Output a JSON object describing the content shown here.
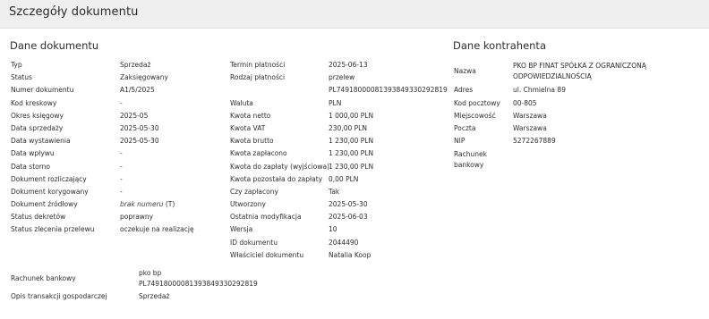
{
  "header": {
    "title": "Szczegóły dokumentu"
  },
  "sections": {
    "document": "Dane dokumentu",
    "contractor": "Dane kontrahenta"
  },
  "col1": [
    {
      "label": "Typ",
      "value": "Sprzedaż"
    },
    {
      "label": "Status",
      "value": "Zaksięgowany"
    },
    {
      "label": "Numer dokumentu",
      "value": "A1/5/2025"
    },
    {
      "label": "Kod kreskowy",
      "value": "-"
    },
    {
      "label": "Okres księgowy",
      "value": "2025-05"
    },
    {
      "label": "Data sprzedaży",
      "value": "2025-05-30"
    },
    {
      "label": "Data wystawienia",
      "value": "2025-05-30"
    },
    {
      "label": "Data wpływu",
      "value": "-"
    },
    {
      "label": "Data storno",
      "value": "-"
    },
    {
      "label": "Dokument rozliczający",
      "value": "-"
    },
    {
      "label": "Dokument korygowany",
      "value": "-"
    },
    {
      "label": "Dokument źródłowy",
      "value": "brak numeru",
      "value_suffix": " (T)"
    },
    {
      "label": "Status dekretów",
      "value": "poprawny"
    },
    {
      "label": "Status zlecenia przelewu",
      "value": "oczekuje na realizację"
    }
  ],
  "col2": [
    {
      "label": "Termin płatności",
      "value": "2025-06-13"
    },
    {
      "label": "Rodzaj płatności",
      "value": "przelew"
    },
    {
      "label": "",
      "value": "PL74918000081393849330292819"
    },
    {
      "label": "Waluta",
      "value": "PLN"
    },
    {
      "label": "Kwota netto",
      "value": "1 000,00 PLN"
    },
    {
      "label": "Kwota VAT",
      "value": "230,00 PLN"
    },
    {
      "label": "Kwota brutto",
      "value": "1 230,00 PLN"
    },
    {
      "label": "Kwota zapłacono",
      "value": "1 230,00 PLN"
    },
    {
      "label": "Kwota do zapłaty (wyjściowa)",
      "value": "1 230,00 PLN"
    },
    {
      "label": "Kwota pozostała do zapłaty",
      "value": "0,00 PLN"
    },
    {
      "label": "Czy zapłacony",
      "value": "Tak"
    },
    {
      "label": "Utworzony",
      "value": "2025-05-30"
    },
    {
      "label": "Ostatnia modyfikacja",
      "value": "2025-06-03"
    },
    {
      "label": "Wersja",
      "value": "10"
    },
    {
      "label": "ID dokumentu",
      "value": "2044490"
    },
    {
      "label": "Właściciel dokumentu",
      "value": "Natalia Koop"
    }
  ],
  "contractor": {
    "name_label": "Nazwa",
    "name_line1": "PKO BP FINAT SPÓŁKA Z OGRANICZONĄ",
    "name_line2": "ODPOWIEDZIALNOŚCIĄ",
    "address_label": "Adres",
    "address": "ul. Chmielna 89",
    "postal_label": "Kod pocztowy",
    "postal": "00-805",
    "city_label": "Miejscowość",
    "city": "Warszawa",
    "post_label": "Poczta",
    "post": "Warszawa",
    "nip_label": "NIP",
    "nip": "5272267889",
    "bank_label_line1": "Rachunek",
    "bank_label_line2": "bankowy"
  },
  "bottom": {
    "bank_label": "Rachunek bankowy",
    "bank_line1": "pko bp",
    "bank_line2": "PL74918000081393849330292819",
    "desc_label": "Opis transakcji gospodarczej",
    "desc_value": "Sprzedaż"
  }
}
